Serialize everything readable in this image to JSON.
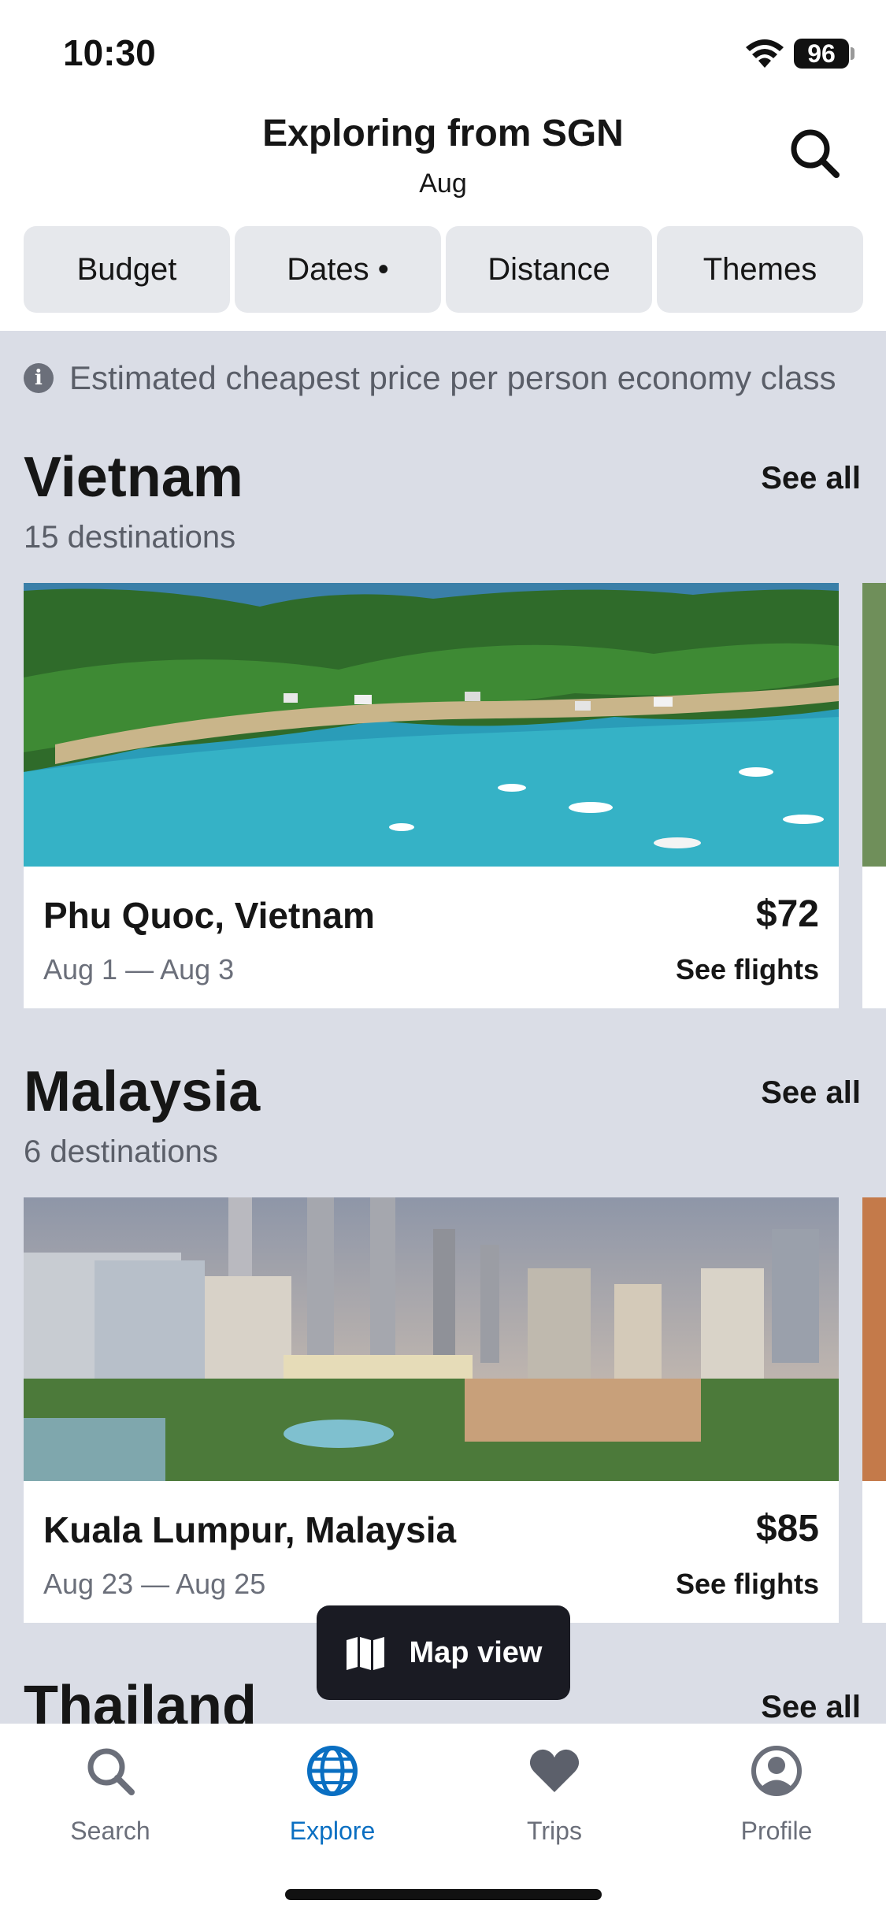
{
  "status_bar": {
    "time": "10:30",
    "battery": "96"
  },
  "header": {
    "title": "Exploring from SGN",
    "subtitle": "Aug",
    "search_icon": "search-icon"
  },
  "filters": [
    {
      "label": "Budget"
    },
    {
      "label": "Dates •"
    },
    {
      "label": "Distance"
    },
    {
      "label": "Themes"
    }
  ],
  "info_note": "Estimated cheapest price per person economy class",
  "sections": [
    {
      "title": "Vietnam",
      "subtitle": "15 destinations",
      "see_all": "See all",
      "card": {
        "name": "Phu Quoc, Vietnam",
        "dates": "Aug 1 — Aug 3",
        "price": "$72",
        "action": "See flights"
      }
    },
    {
      "title": "Malaysia",
      "subtitle": "6 destinations",
      "see_all": "See all",
      "card": {
        "name": "Kuala Lumpur, Malaysia",
        "dates": "Aug 23 — Aug 25",
        "price": "$85",
        "action": "See flights"
      }
    },
    {
      "title": "Thailand",
      "see_all": "See all"
    }
  ],
  "map_button": {
    "label": "Map view",
    "icon": "map-icon"
  },
  "tabs": [
    {
      "label": "Search",
      "icon": "search-icon"
    },
    {
      "label": "Explore",
      "icon": "globe-icon",
      "active": true
    },
    {
      "label": "Trips",
      "icon": "heart-icon"
    },
    {
      "label": "Profile",
      "icon": "profile-icon"
    }
  ],
  "colors": {
    "accent": "#0a6fc2",
    "background": "#dadde6",
    "chip": "#e6e8ec",
    "dark": "#1a1b23"
  }
}
